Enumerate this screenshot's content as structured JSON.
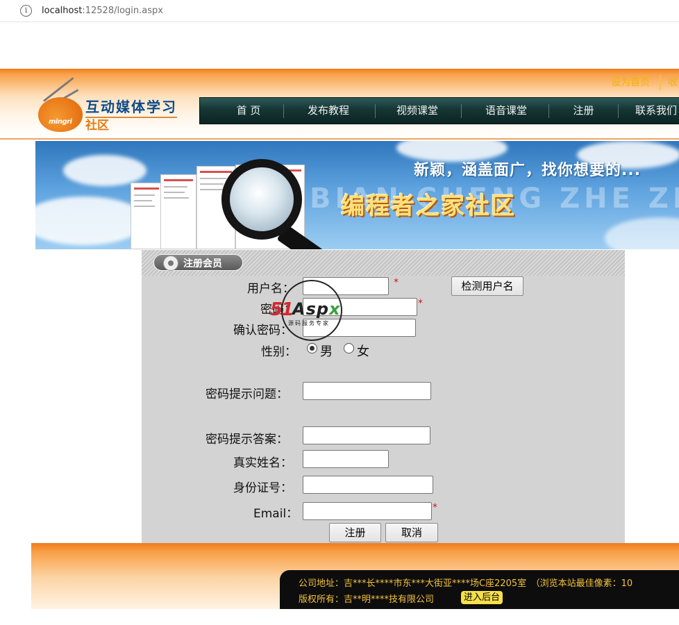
{
  "browser": {
    "url_host": "localhost",
    "url_rest": ":12528/login.aspx",
    "info_icon": "i"
  },
  "header": {
    "set_home": "设为首页",
    "favorite": "收",
    "logo_title": "互动媒体学习",
    "logo_sub": "社区",
    "logo_brand": "mingri"
  },
  "nav": {
    "items": [
      "首 页",
      "发布教程",
      "视频课堂",
      "语音课堂",
      "注册",
      "联系我们"
    ]
  },
  "banner": {
    "slogan": "新颖，涵盖面广，找你想要的...",
    "title": "编程者之家社区",
    "ghost_text": "BIAN CHENG ZHE ZHI"
  },
  "panel": {
    "tab_label": "注册会员"
  },
  "form": {
    "username_label": "用户名：",
    "password_label": "密码：",
    "confirm_label": "确认密码：",
    "gender_label": "性别：",
    "gender_options": [
      "男",
      "女"
    ],
    "gender_selected": "男",
    "question_label": "密码提示问题：",
    "answer_label": "密码提示答案：",
    "realname_label": "真实姓名：",
    "idcard_label": "身份证号：",
    "email_label": "Email：",
    "required_mark": "*",
    "check_button": "检测用户名",
    "register_button": "注册",
    "cancel_button": "取消",
    "values": {
      "username": "",
      "password": "",
      "confirm": "",
      "question": "",
      "answer": "",
      "realname": "",
      "idcard": "",
      "email": ""
    }
  },
  "watermark": {
    "num": "51",
    "brand_a": "As",
    "brand_p": "p",
    "brand_x": "x",
    "tag": "源码服务专家"
  },
  "footer": {
    "address": "公司地址：吉***长****市东***大街亚****场C座2205室　（浏览本站最佳像素：10",
    "copyright": "版权所有：吉**明****技有限公司",
    "admin_button": "进入后台"
  },
  "colors": {
    "accent_orange": "#f07c1c",
    "nav_dark": "#153634",
    "required_red": "#d0181a",
    "footer_text": "#f4c23c"
  }
}
